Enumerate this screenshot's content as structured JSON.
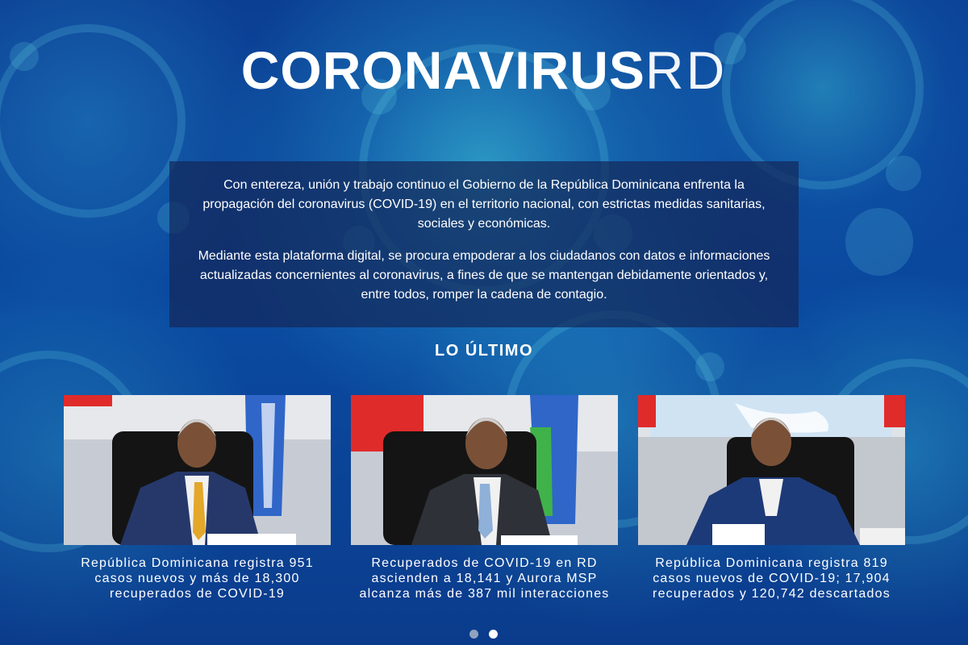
{
  "hero": {
    "title_bold": "CORONAVIRUS",
    "title_light": "RD"
  },
  "intro": {
    "paragraph_1": "Con entereza, unión y trabajo continuo el Gobierno de la República Dominicana enfrenta la propagación del coronavirus (COVID-19) en el territorio nacional, con estrictas medidas sanitarias, sociales y económicas.",
    "paragraph_2": "Mediante esta plataforma digital, se procura empoderar a los ciudadanos con datos e informaciones actualizadas concernientes al coronavirus, a fines de que se mantengan debidamente orientados y, entre todos, romper la cadena de contagio."
  },
  "latest": {
    "heading": "LO ÚLTIMO",
    "cards": [
      {
        "caption": "República Dominicana registra 951 casos nuevos y más de 18,300 recuperados de COVID-19"
      },
      {
        "caption": "Recuperados de COVID-19 en RD ascienden a 18,141 y Aurora MSP alcanza más de 387 mil interacciones"
      },
      {
        "caption": "República Dominicana registra 819 casos nuevos de COVID-19; 17,904 recuperados y 120,742 descartados"
      }
    ]
  },
  "carousel": {
    "active_dot": 2
  },
  "colors": {
    "background": "#0a3d8f",
    "accent_cyan": "#46dce6",
    "intro_panel": "#14285a"
  }
}
